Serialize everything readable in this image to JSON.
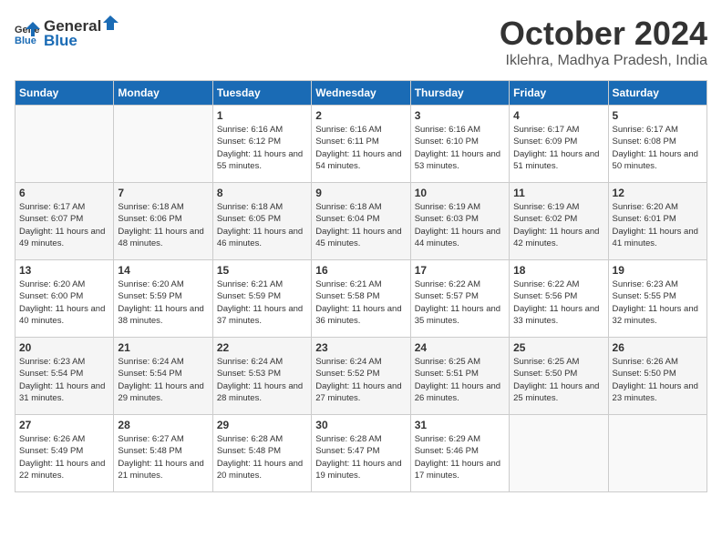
{
  "header": {
    "logo_line1": "General",
    "logo_line2": "Blue",
    "month": "October 2024",
    "location": "Iklehra, Madhya Pradesh, India"
  },
  "weekdays": [
    "Sunday",
    "Monday",
    "Tuesday",
    "Wednesday",
    "Thursday",
    "Friday",
    "Saturday"
  ],
  "weeks": [
    [
      {
        "day": "",
        "info": ""
      },
      {
        "day": "",
        "info": ""
      },
      {
        "day": "1",
        "info": "Sunrise: 6:16 AM\nSunset: 6:12 PM\nDaylight: 11 hours and 55 minutes."
      },
      {
        "day": "2",
        "info": "Sunrise: 6:16 AM\nSunset: 6:11 PM\nDaylight: 11 hours and 54 minutes."
      },
      {
        "day": "3",
        "info": "Sunrise: 6:16 AM\nSunset: 6:10 PM\nDaylight: 11 hours and 53 minutes."
      },
      {
        "day": "4",
        "info": "Sunrise: 6:17 AM\nSunset: 6:09 PM\nDaylight: 11 hours and 51 minutes."
      },
      {
        "day": "5",
        "info": "Sunrise: 6:17 AM\nSunset: 6:08 PM\nDaylight: 11 hours and 50 minutes."
      }
    ],
    [
      {
        "day": "6",
        "info": "Sunrise: 6:17 AM\nSunset: 6:07 PM\nDaylight: 11 hours and 49 minutes."
      },
      {
        "day": "7",
        "info": "Sunrise: 6:18 AM\nSunset: 6:06 PM\nDaylight: 11 hours and 48 minutes."
      },
      {
        "day": "8",
        "info": "Sunrise: 6:18 AM\nSunset: 6:05 PM\nDaylight: 11 hours and 46 minutes."
      },
      {
        "day": "9",
        "info": "Sunrise: 6:18 AM\nSunset: 6:04 PM\nDaylight: 11 hours and 45 minutes."
      },
      {
        "day": "10",
        "info": "Sunrise: 6:19 AM\nSunset: 6:03 PM\nDaylight: 11 hours and 44 minutes."
      },
      {
        "day": "11",
        "info": "Sunrise: 6:19 AM\nSunset: 6:02 PM\nDaylight: 11 hours and 42 minutes."
      },
      {
        "day": "12",
        "info": "Sunrise: 6:20 AM\nSunset: 6:01 PM\nDaylight: 11 hours and 41 minutes."
      }
    ],
    [
      {
        "day": "13",
        "info": "Sunrise: 6:20 AM\nSunset: 6:00 PM\nDaylight: 11 hours and 40 minutes."
      },
      {
        "day": "14",
        "info": "Sunrise: 6:20 AM\nSunset: 5:59 PM\nDaylight: 11 hours and 38 minutes."
      },
      {
        "day": "15",
        "info": "Sunrise: 6:21 AM\nSunset: 5:59 PM\nDaylight: 11 hours and 37 minutes."
      },
      {
        "day": "16",
        "info": "Sunrise: 6:21 AM\nSunset: 5:58 PM\nDaylight: 11 hours and 36 minutes."
      },
      {
        "day": "17",
        "info": "Sunrise: 6:22 AM\nSunset: 5:57 PM\nDaylight: 11 hours and 35 minutes."
      },
      {
        "day": "18",
        "info": "Sunrise: 6:22 AM\nSunset: 5:56 PM\nDaylight: 11 hours and 33 minutes."
      },
      {
        "day": "19",
        "info": "Sunrise: 6:23 AM\nSunset: 5:55 PM\nDaylight: 11 hours and 32 minutes."
      }
    ],
    [
      {
        "day": "20",
        "info": "Sunrise: 6:23 AM\nSunset: 5:54 PM\nDaylight: 11 hours and 31 minutes."
      },
      {
        "day": "21",
        "info": "Sunrise: 6:24 AM\nSunset: 5:54 PM\nDaylight: 11 hours and 29 minutes."
      },
      {
        "day": "22",
        "info": "Sunrise: 6:24 AM\nSunset: 5:53 PM\nDaylight: 11 hours and 28 minutes."
      },
      {
        "day": "23",
        "info": "Sunrise: 6:24 AM\nSunset: 5:52 PM\nDaylight: 11 hours and 27 minutes."
      },
      {
        "day": "24",
        "info": "Sunrise: 6:25 AM\nSunset: 5:51 PM\nDaylight: 11 hours and 26 minutes."
      },
      {
        "day": "25",
        "info": "Sunrise: 6:25 AM\nSunset: 5:50 PM\nDaylight: 11 hours and 25 minutes."
      },
      {
        "day": "26",
        "info": "Sunrise: 6:26 AM\nSunset: 5:50 PM\nDaylight: 11 hours and 23 minutes."
      }
    ],
    [
      {
        "day": "27",
        "info": "Sunrise: 6:26 AM\nSunset: 5:49 PM\nDaylight: 11 hours and 22 minutes."
      },
      {
        "day": "28",
        "info": "Sunrise: 6:27 AM\nSunset: 5:48 PM\nDaylight: 11 hours and 21 minutes."
      },
      {
        "day": "29",
        "info": "Sunrise: 6:28 AM\nSunset: 5:48 PM\nDaylight: 11 hours and 20 minutes."
      },
      {
        "day": "30",
        "info": "Sunrise: 6:28 AM\nSunset: 5:47 PM\nDaylight: 11 hours and 19 minutes."
      },
      {
        "day": "31",
        "info": "Sunrise: 6:29 AM\nSunset: 5:46 PM\nDaylight: 11 hours and 17 minutes."
      },
      {
        "day": "",
        "info": ""
      },
      {
        "day": "",
        "info": ""
      }
    ]
  ]
}
